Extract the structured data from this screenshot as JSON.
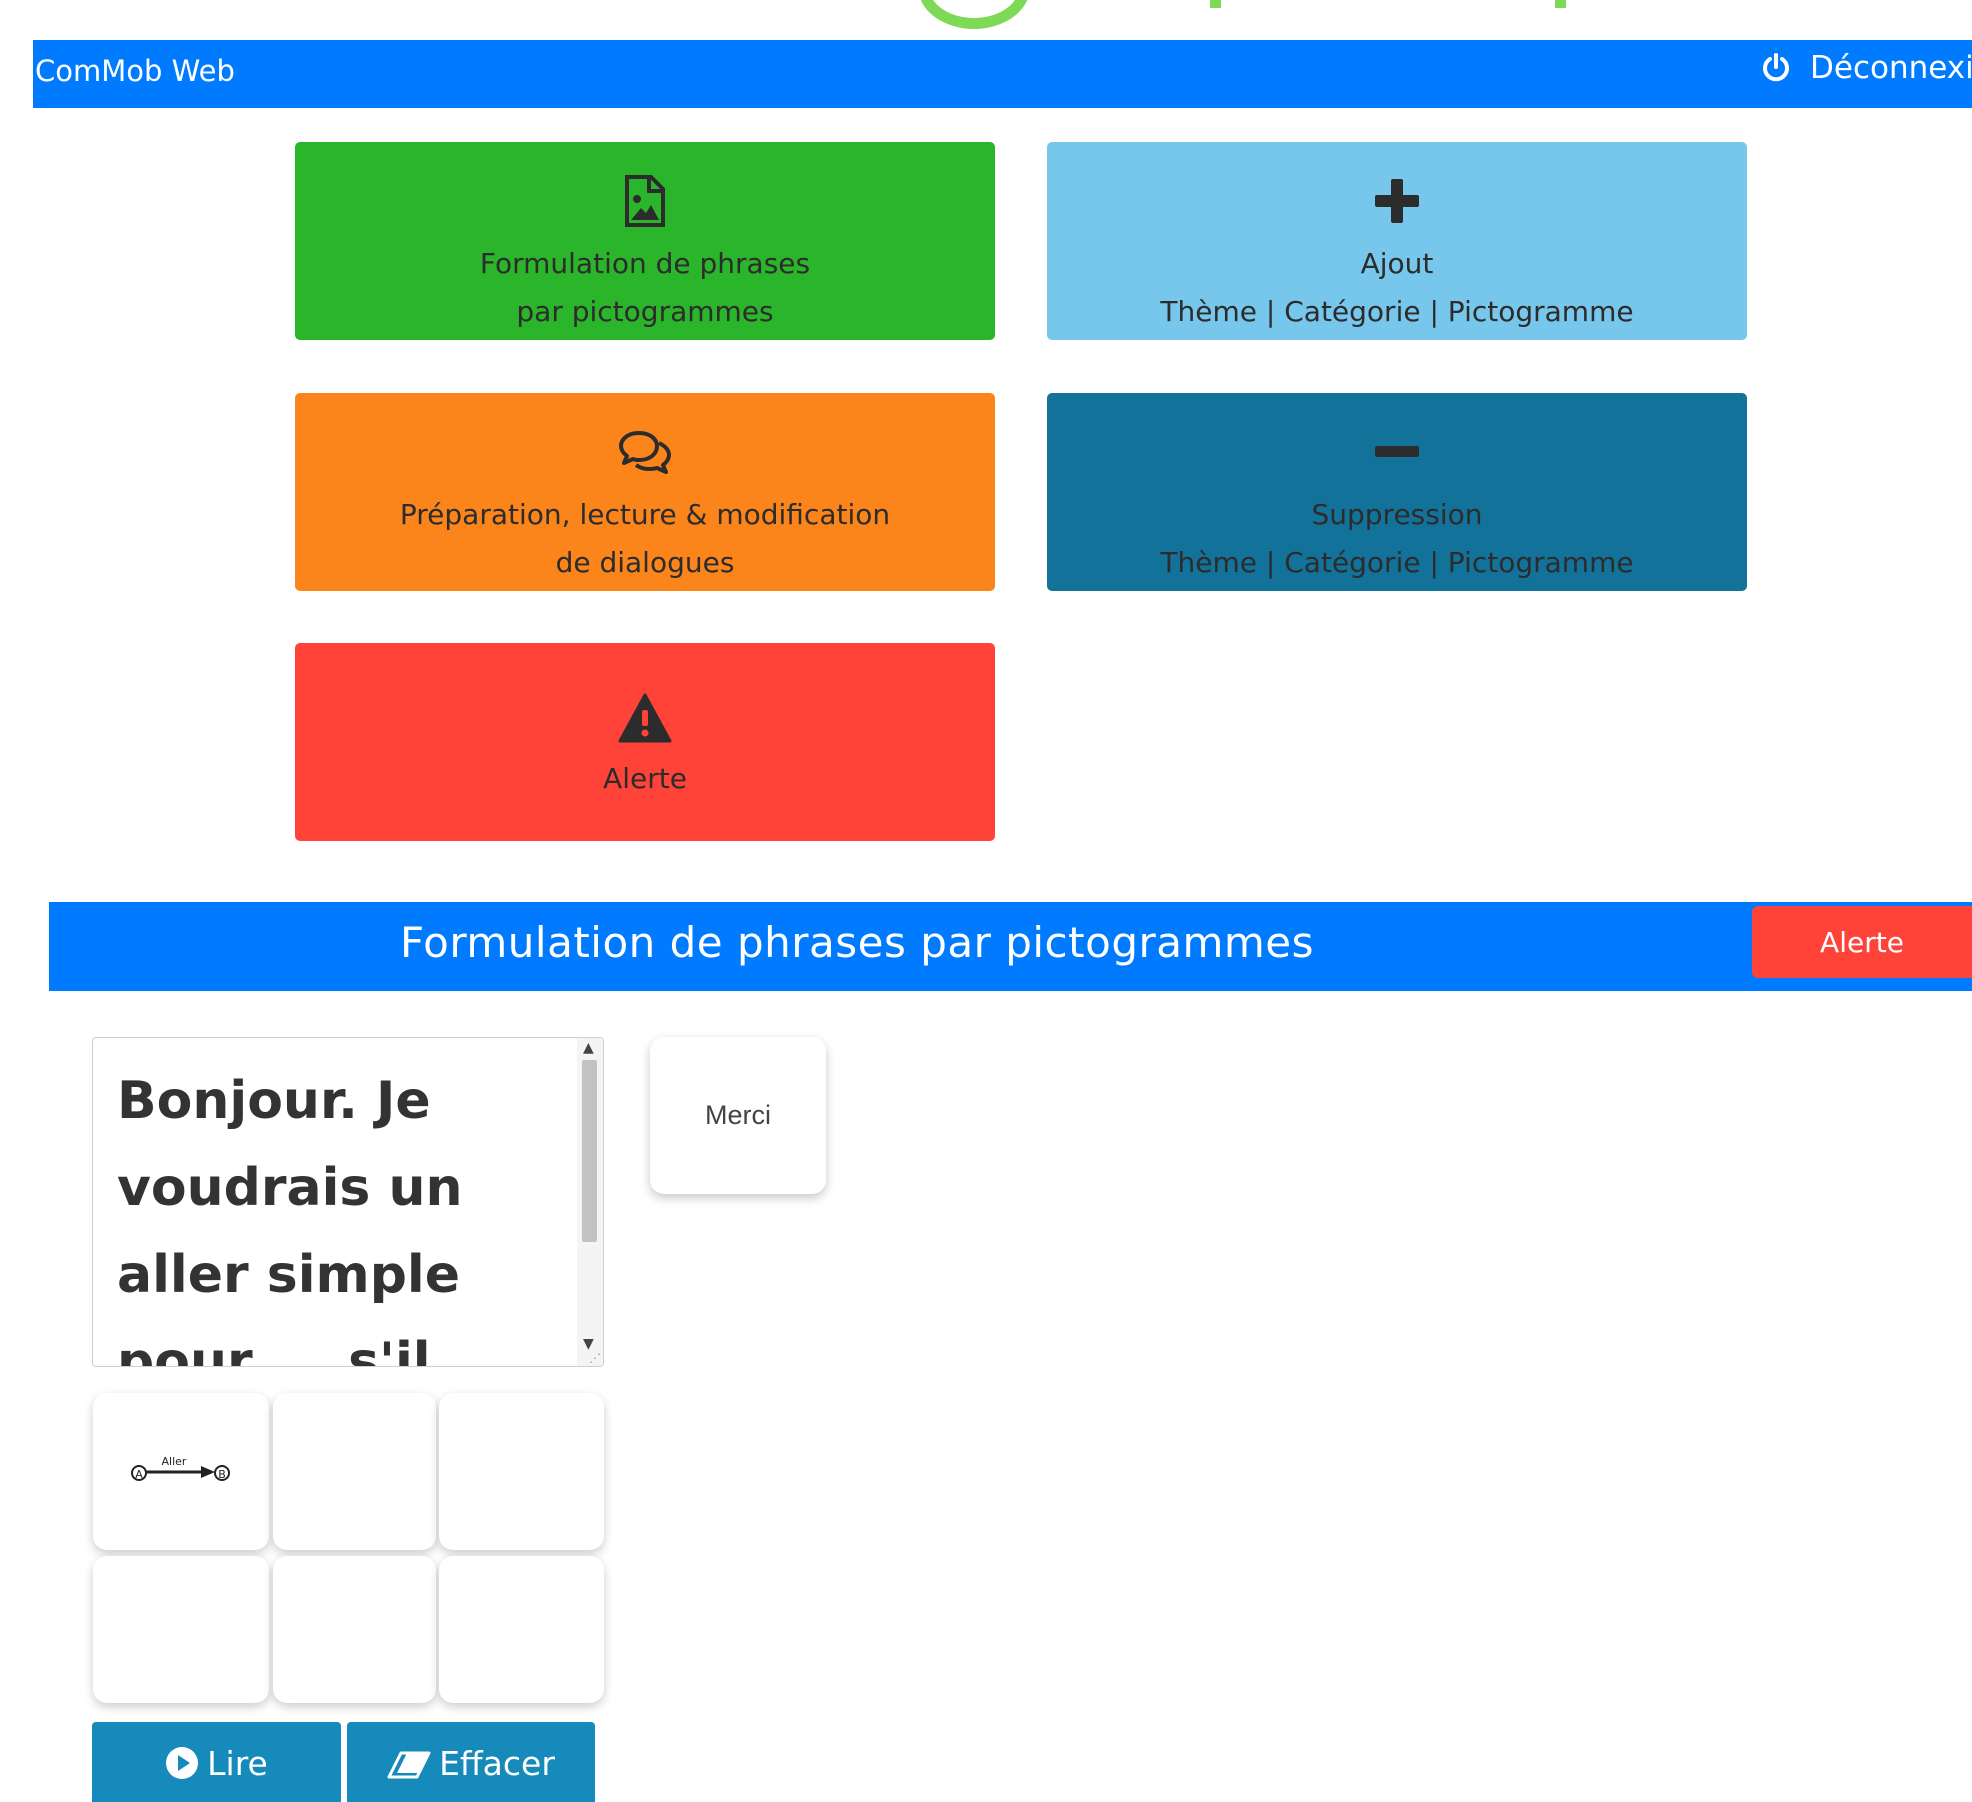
{
  "navbar": {
    "brand": "ComMob Web",
    "logout_label": "Déconnexion"
  },
  "tiles": [
    {
      "line1": "Formulation de phrases",
      "line2": "par pictogrammes",
      "color": "#2bb52b",
      "icon": "image-file-icon"
    },
    {
      "line1": "Ajout",
      "line2": "Thème | Catégorie | Pictogramme",
      "color": "#76c7eb",
      "icon": "plus-icon"
    },
    {
      "line1": "Préparation, lecture & modification",
      "line2": "de dialogues",
      "color": "#fc851b",
      "icon": "comments-icon"
    },
    {
      "line1": "Suppression",
      "line2": "Thème | Catégorie | Pictogramme",
      "color": "#13729a",
      "icon": "minus-icon"
    },
    {
      "line1": "Alerte",
      "color": "#ff4339",
      "icon": "warning-icon"
    }
  ],
  "section": {
    "title": "Formulation de phrases par pictogrammes",
    "alert_label": "Alerte"
  },
  "phrase": {
    "text": "Bonjour. Je voudrais un aller simple pour ... s'il"
  },
  "suggestion": {
    "label": "Merci"
  },
  "picto_slot_1": {
    "text_a": "A",
    "text_mid": "Aller",
    "text_b": "B"
  },
  "actions": {
    "read_label": "Lire",
    "clear_label": "Effacer"
  },
  "colors": {
    "primary": "#007bff",
    "danger": "#ff4339",
    "info": "#168aba"
  }
}
